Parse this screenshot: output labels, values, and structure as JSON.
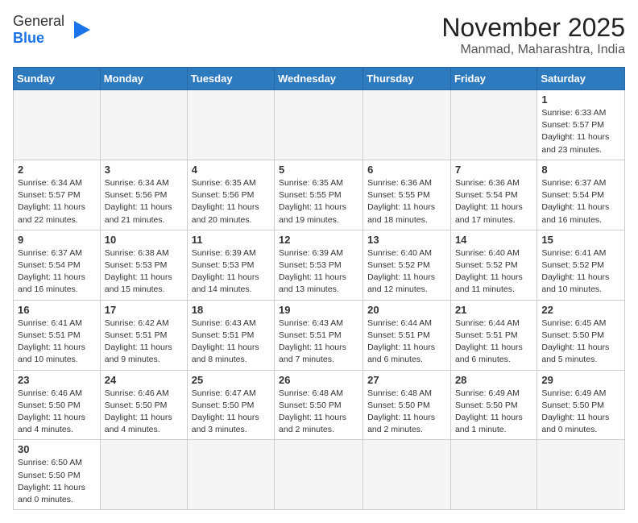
{
  "header": {
    "logo_general": "General",
    "logo_blue": "Blue",
    "month": "November 2025",
    "location": "Manmad, Maharashtra, India"
  },
  "weekdays": [
    "Sunday",
    "Monday",
    "Tuesday",
    "Wednesday",
    "Thursday",
    "Friday",
    "Saturday"
  ],
  "rows": [
    [
      {
        "day": "",
        "text": ""
      },
      {
        "day": "",
        "text": ""
      },
      {
        "day": "",
        "text": ""
      },
      {
        "day": "",
        "text": ""
      },
      {
        "day": "",
        "text": ""
      },
      {
        "day": "",
        "text": ""
      },
      {
        "day": "1",
        "text": "Sunrise: 6:33 AM\nSunset: 5:57 PM\nDaylight: 11 hours\nand 23 minutes."
      }
    ],
    [
      {
        "day": "2",
        "text": "Sunrise: 6:34 AM\nSunset: 5:57 PM\nDaylight: 11 hours\nand 22 minutes."
      },
      {
        "day": "3",
        "text": "Sunrise: 6:34 AM\nSunset: 5:56 PM\nDaylight: 11 hours\nand 21 minutes."
      },
      {
        "day": "4",
        "text": "Sunrise: 6:35 AM\nSunset: 5:56 PM\nDaylight: 11 hours\nand 20 minutes."
      },
      {
        "day": "5",
        "text": "Sunrise: 6:35 AM\nSunset: 5:55 PM\nDaylight: 11 hours\nand 19 minutes."
      },
      {
        "day": "6",
        "text": "Sunrise: 6:36 AM\nSunset: 5:55 PM\nDaylight: 11 hours\nand 18 minutes."
      },
      {
        "day": "7",
        "text": "Sunrise: 6:36 AM\nSunset: 5:54 PM\nDaylight: 11 hours\nand 17 minutes."
      },
      {
        "day": "8",
        "text": "Sunrise: 6:37 AM\nSunset: 5:54 PM\nDaylight: 11 hours\nand 16 minutes."
      }
    ],
    [
      {
        "day": "9",
        "text": "Sunrise: 6:37 AM\nSunset: 5:54 PM\nDaylight: 11 hours\nand 16 minutes."
      },
      {
        "day": "10",
        "text": "Sunrise: 6:38 AM\nSunset: 5:53 PM\nDaylight: 11 hours\nand 15 minutes."
      },
      {
        "day": "11",
        "text": "Sunrise: 6:39 AM\nSunset: 5:53 PM\nDaylight: 11 hours\nand 14 minutes."
      },
      {
        "day": "12",
        "text": "Sunrise: 6:39 AM\nSunset: 5:53 PM\nDaylight: 11 hours\nand 13 minutes."
      },
      {
        "day": "13",
        "text": "Sunrise: 6:40 AM\nSunset: 5:52 PM\nDaylight: 11 hours\nand 12 minutes."
      },
      {
        "day": "14",
        "text": "Sunrise: 6:40 AM\nSunset: 5:52 PM\nDaylight: 11 hours\nand 11 minutes."
      },
      {
        "day": "15",
        "text": "Sunrise: 6:41 AM\nSunset: 5:52 PM\nDaylight: 11 hours\nand 10 minutes."
      }
    ],
    [
      {
        "day": "16",
        "text": "Sunrise: 6:41 AM\nSunset: 5:51 PM\nDaylight: 11 hours\nand 10 minutes."
      },
      {
        "day": "17",
        "text": "Sunrise: 6:42 AM\nSunset: 5:51 PM\nDaylight: 11 hours\nand 9 minutes."
      },
      {
        "day": "18",
        "text": "Sunrise: 6:43 AM\nSunset: 5:51 PM\nDaylight: 11 hours\nand 8 minutes."
      },
      {
        "day": "19",
        "text": "Sunrise: 6:43 AM\nSunset: 5:51 PM\nDaylight: 11 hours\nand 7 minutes."
      },
      {
        "day": "20",
        "text": "Sunrise: 6:44 AM\nSunset: 5:51 PM\nDaylight: 11 hours\nand 6 minutes."
      },
      {
        "day": "21",
        "text": "Sunrise: 6:44 AM\nSunset: 5:51 PM\nDaylight: 11 hours\nand 6 minutes."
      },
      {
        "day": "22",
        "text": "Sunrise: 6:45 AM\nSunset: 5:50 PM\nDaylight: 11 hours\nand 5 minutes."
      }
    ],
    [
      {
        "day": "23",
        "text": "Sunrise: 6:46 AM\nSunset: 5:50 PM\nDaylight: 11 hours\nand 4 minutes."
      },
      {
        "day": "24",
        "text": "Sunrise: 6:46 AM\nSunset: 5:50 PM\nDaylight: 11 hours\nand 4 minutes."
      },
      {
        "day": "25",
        "text": "Sunrise: 6:47 AM\nSunset: 5:50 PM\nDaylight: 11 hours\nand 3 minutes."
      },
      {
        "day": "26",
        "text": "Sunrise: 6:48 AM\nSunset: 5:50 PM\nDaylight: 11 hours\nand 2 minutes."
      },
      {
        "day": "27",
        "text": "Sunrise: 6:48 AM\nSunset: 5:50 PM\nDaylight: 11 hours\nand 2 minutes."
      },
      {
        "day": "28",
        "text": "Sunrise: 6:49 AM\nSunset: 5:50 PM\nDaylight: 11 hours\nand 1 minute."
      },
      {
        "day": "29",
        "text": "Sunrise: 6:49 AM\nSunset: 5:50 PM\nDaylight: 11 hours\nand 0 minutes."
      }
    ],
    [
      {
        "day": "30",
        "text": "Sunrise: 6:50 AM\nSunset: 5:50 PM\nDaylight: 11 hours\nand 0 minutes."
      },
      {
        "day": "",
        "text": ""
      },
      {
        "day": "",
        "text": ""
      },
      {
        "day": "",
        "text": ""
      },
      {
        "day": "",
        "text": ""
      },
      {
        "day": "",
        "text": ""
      },
      {
        "day": "",
        "text": ""
      }
    ]
  ]
}
